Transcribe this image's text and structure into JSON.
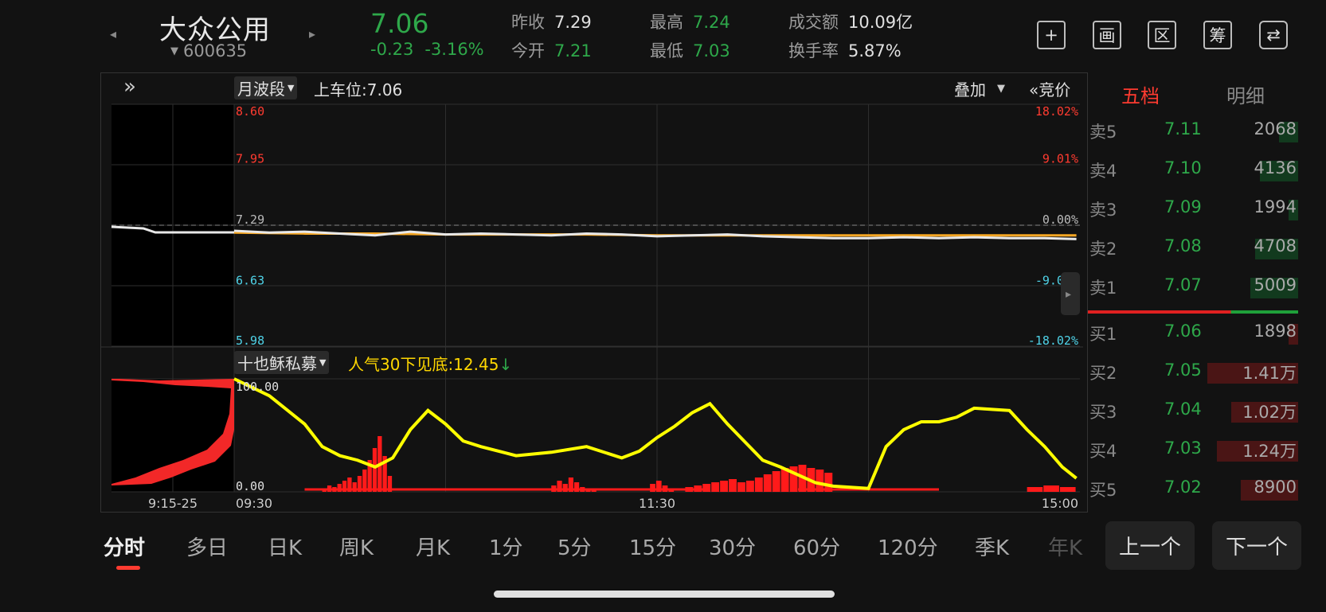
{
  "header": {
    "name": "大众公用",
    "code": "600635",
    "price": "7.06",
    "change": "-0.23",
    "change_pct": "-3.16%",
    "stats": [
      {
        "label": "昨收",
        "value": "7.29",
        "color": "#e0e0e0"
      },
      {
        "label": "今开",
        "value": "7.21",
        "color": "#2ea84a"
      },
      {
        "label": "最高",
        "value": "7.24",
        "color": "#2ea84a"
      },
      {
        "label": "最低",
        "value": "7.03",
        "color": "#2ea84a"
      },
      {
        "label": "成交额",
        "value": "10.09亿",
        "color": "#e0e0e0"
      },
      {
        "label": "换手率",
        "value": "5.87%",
        "color": "#e0e0e0"
      }
    ],
    "tools": [
      {
        "name": "add-icon",
        "glyph": "+"
      },
      {
        "name": "draw-icon",
        "glyph": "画"
      },
      {
        "name": "range-icon",
        "glyph": "区"
      },
      {
        "name": "chip-icon",
        "glyph": "筹"
      },
      {
        "name": "switch-device-icon",
        "glyph": "⇄"
      }
    ]
  },
  "chart": {
    "expand": "»",
    "indicator_select": "月波段",
    "indicator_value": "上车位:7.06",
    "overlay": "叠加",
    "auction": "«竞价",
    "price_ticks": [
      {
        "label": "8.60",
        "pct": "18.02%",
        "price": 8.6,
        "color": "#ff3b30"
      },
      {
        "label": "7.95",
        "pct": "9.01%",
        "price": 7.95,
        "color": "#ff3b30"
      },
      {
        "label": "7.29",
        "pct": "0.00%",
        "price": 7.29,
        "color": "#bbbbbb"
      },
      {
        "label": "6.63",
        "pct": "-9.01%",
        "price": 6.63,
        "color": "#4fd3e8"
      },
      {
        "label": "5.98",
        "pct": "-18.02%",
        "price": 5.98,
        "color": "#4fd3e8"
      }
    ],
    "sub_select": "十也稣私募",
    "sub_value": "人气30下见底:12.45",
    "sub_arrow": "↓",
    "sub_ticks": [
      "100.00",
      "0.00"
    ],
    "time_labels": [
      "9:15-25",
      "09:30",
      "11:30",
      "15:00"
    ]
  },
  "chart_data": {
    "type": "line",
    "series": [
      {
        "name": "price",
        "x": [
          0,
          10,
          20,
          30,
          40,
          50,
          60,
          70,
          80,
          90,
          100,
          110,
          120,
          130,
          140,
          150,
          160,
          170,
          180,
          190,
          200,
          210,
          220,
          230,
          239
        ],
        "values": [
          7.23,
          7.21,
          7.22,
          7.2,
          7.18,
          7.22,
          7.19,
          7.2,
          7.19,
          7.18,
          7.2,
          7.19,
          7.17,
          7.18,
          7.19,
          7.17,
          7.16,
          7.15,
          7.15,
          7.16,
          7.15,
          7.16,
          7.15,
          7.15,
          7.14
        ]
      },
      {
        "name": "avg",
        "x": [
          0,
          20,
          40,
          60,
          80,
          100,
          120,
          140,
          160,
          180,
          200,
          220,
          239
        ],
        "values": [
          7.21,
          7.2,
          7.2,
          7.19,
          7.19,
          7.19,
          7.18,
          7.18,
          7.18,
          7.18,
          7.18,
          7.18,
          7.18
        ]
      },
      {
        "name": "人气",
        "x": [
          0,
          10,
          20,
          25,
          30,
          35,
          40,
          45,
          50,
          55,
          60,
          65,
          70,
          80,
          90,
          100,
          110,
          115,
          120,
          125,
          130,
          135,
          140,
          150,
          155,
          160,
          165,
          170,
          180,
          185,
          190,
          195,
          200,
          205,
          210,
          215,
          220,
          225,
          230,
          235,
          239
        ],
        "values": [
          100,
          85,
          60,
          40,
          32,
          28,
          22,
          30,
          55,
          72,
          60,
          45,
          40,
          32,
          35,
          40,
          30,
          36,
          48,
          58,
          70,
          78,
          60,
          28,
          22,
          15,
          8,
          5,
          3,
          40,
          55,
          62,
          62,
          66,
          74,
          73,
          72,
          55,
          40,
          22,
          12
        ]
      }
    ],
    "ylim": [
      5.98,
      8.6
    ],
    "sub_ylim": [
      0,
      100
    ]
  },
  "orderbook": {
    "tabs": [
      "五档",
      "明细"
    ],
    "sells": [
      {
        "label": "卖5",
        "price": "7.11",
        "vol": "2068"
      },
      {
        "label": "卖4",
        "price": "7.10",
        "vol": "4136"
      },
      {
        "label": "卖3",
        "price": "7.09",
        "vol": "1994"
      },
      {
        "label": "卖2",
        "price": "7.08",
        "vol": "4708"
      },
      {
        "label": "卖1",
        "price": "7.07",
        "vol": "5009"
      }
    ],
    "buys": [
      {
        "label": "买1",
        "price": "7.06",
        "vol": "1898"
      },
      {
        "label": "买2",
        "price": "7.05",
        "vol": "1.41万"
      },
      {
        "label": "买3",
        "price": "7.04",
        "vol": "1.02万"
      },
      {
        "label": "买4",
        "price": "7.03",
        "vol": "1.24万"
      },
      {
        "label": "买5",
        "price": "7.02",
        "vol": "8900"
      }
    ]
  },
  "periods": [
    "分时",
    "多日",
    "日K",
    "周K",
    "月K",
    "1分",
    "5分",
    "15分",
    "30分",
    "60分",
    "120分",
    "季K",
    "年K"
  ],
  "nav": {
    "prev": "上一个",
    "next": "下一个"
  }
}
